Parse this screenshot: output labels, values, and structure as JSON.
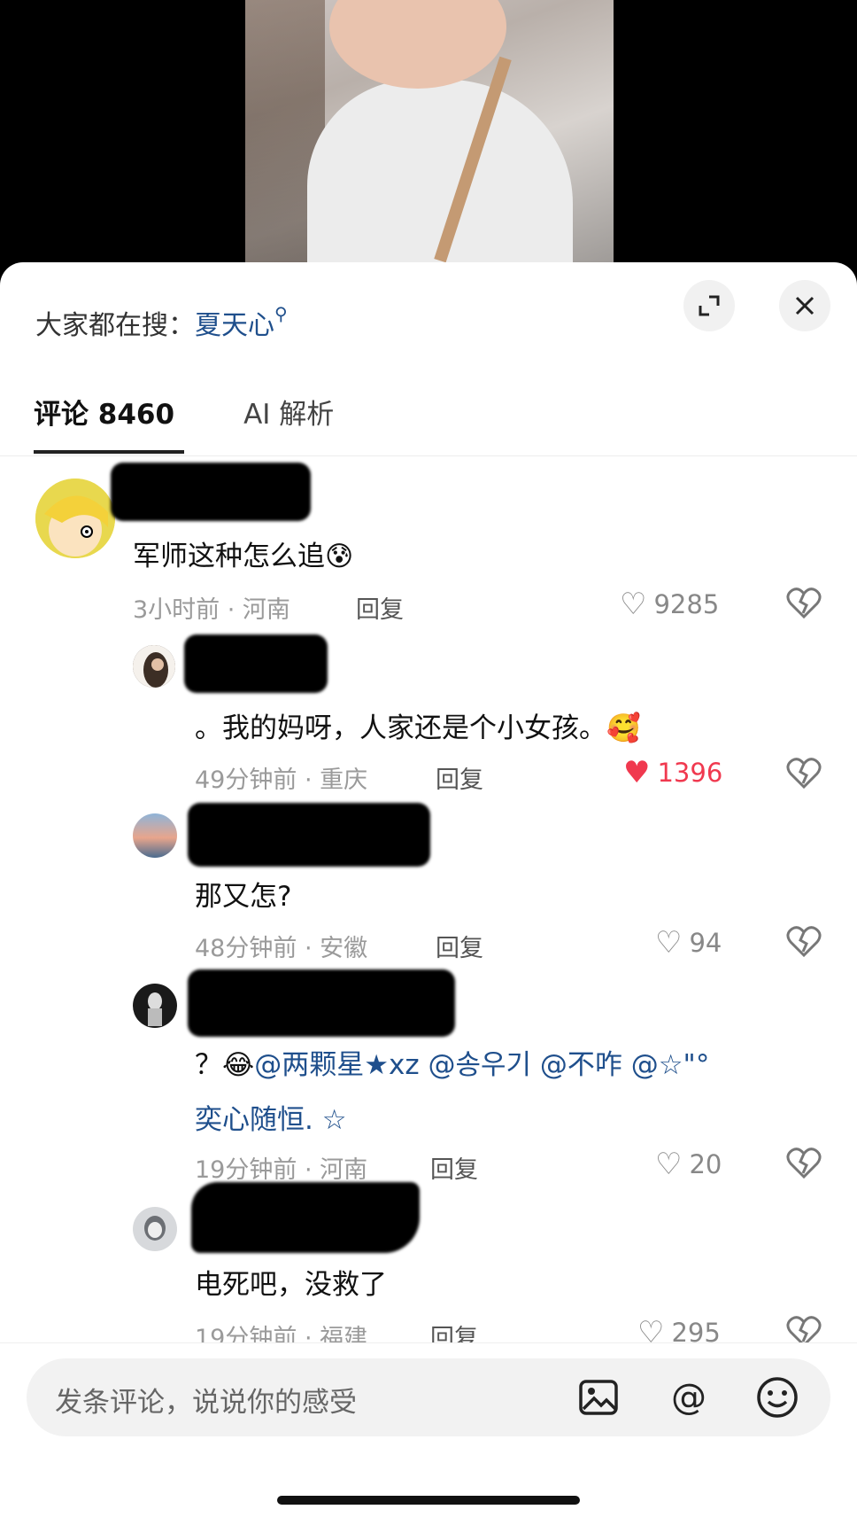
{
  "search": {
    "prefix": "大家都在搜：",
    "keyword": "夏天心",
    "search_icon": "search-icon"
  },
  "header_buttons": {
    "expand_icon": "expand-icon",
    "close_icon": "close-icon"
  },
  "tabs": [
    {
      "label": "评论 8460",
      "active": true
    },
    {
      "label": "AI 解析",
      "active": false
    }
  ],
  "comments": [
    {
      "text": "军师这种怎么追😰",
      "time_loc": "3小时前 · 河南",
      "reply": "回复",
      "likes": "9285",
      "liked": false
    },
    {
      "text": "。我的妈呀，人家还是个小女孩。🥰",
      "time_loc": "49分钟前 · 重庆",
      "reply": "回复",
      "likes": "1396",
      "liked": true
    },
    {
      "text": "那又怎?",
      "time_loc": "48分钟前 · 安徽",
      "reply": "回复",
      "likes": "94",
      "liked": false
    },
    {
      "text_prefix": "？😂",
      "mentions_line1": "@两颗星★xz @송우기 @不咋 @☆\"°",
      "mentions_line2": "奕心随恒.  ☆",
      "time_loc": "19分钟前 · 河南",
      "reply": "回复",
      "likes": "20",
      "liked": false
    },
    {
      "text": "电死吧，没救了",
      "time_loc": "19分钟前 · 福建",
      "reply": "回复",
      "likes": "295",
      "liked": false
    }
  ],
  "input": {
    "placeholder": "发条评论，说说你的感受"
  },
  "icons": {
    "image": "image-icon",
    "at": "@",
    "emoji": "emoji-icon",
    "heart": "heart-icon",
    "dislike": "broken-heart-icon"
  },
  "colors": {
    "accent_link": "#1f4f8c",
    "liked_red": "#f0394f"
  }
}
